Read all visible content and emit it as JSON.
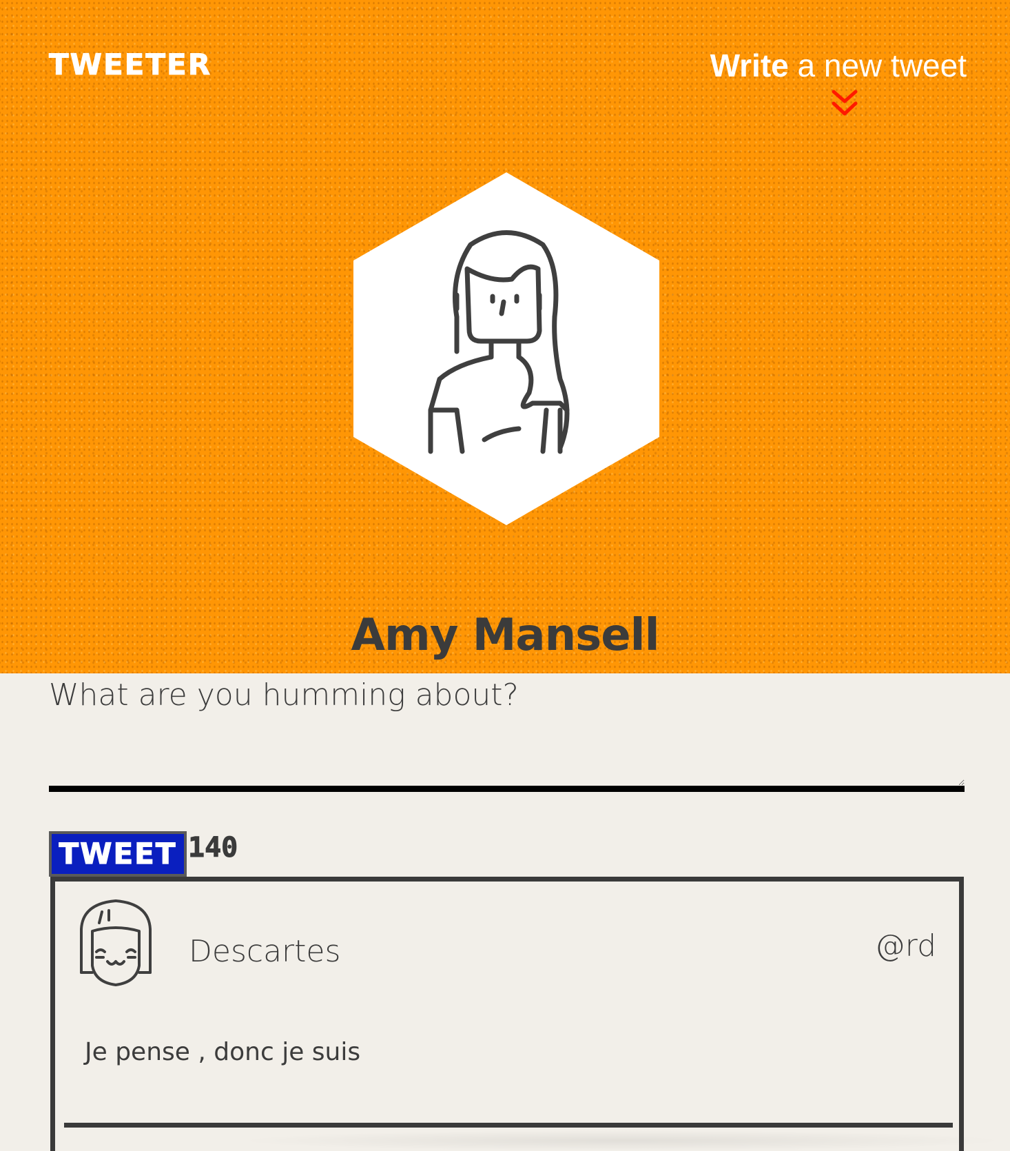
{
  "header": {
    "logo": "TWEETER",
    "write_link": {
      "strong": "Write",
      "rest": " a new tweet"
    },
    "background_color": "#ff9605"
  },
  "profile": {
    "name": "Amy Mansell",
    "avatar_icon": "woman-avatar-icon"
  },
  "composer": {
    "placeholder": "What are you humming about?",
    "value": ""
  },
  "actions": {
    "tweet_label": "TWEET",
    "char_count": "140",
    "button_color": "#0a1fbf"
  },
  "tweets": [
    {
      "user": "Descartes",
      "handle": "@rd",
      "text": "Je pense , donc je suis",
      "avatar_icon": "smiling-girl-avatar-icon"
    }
  ]
}
